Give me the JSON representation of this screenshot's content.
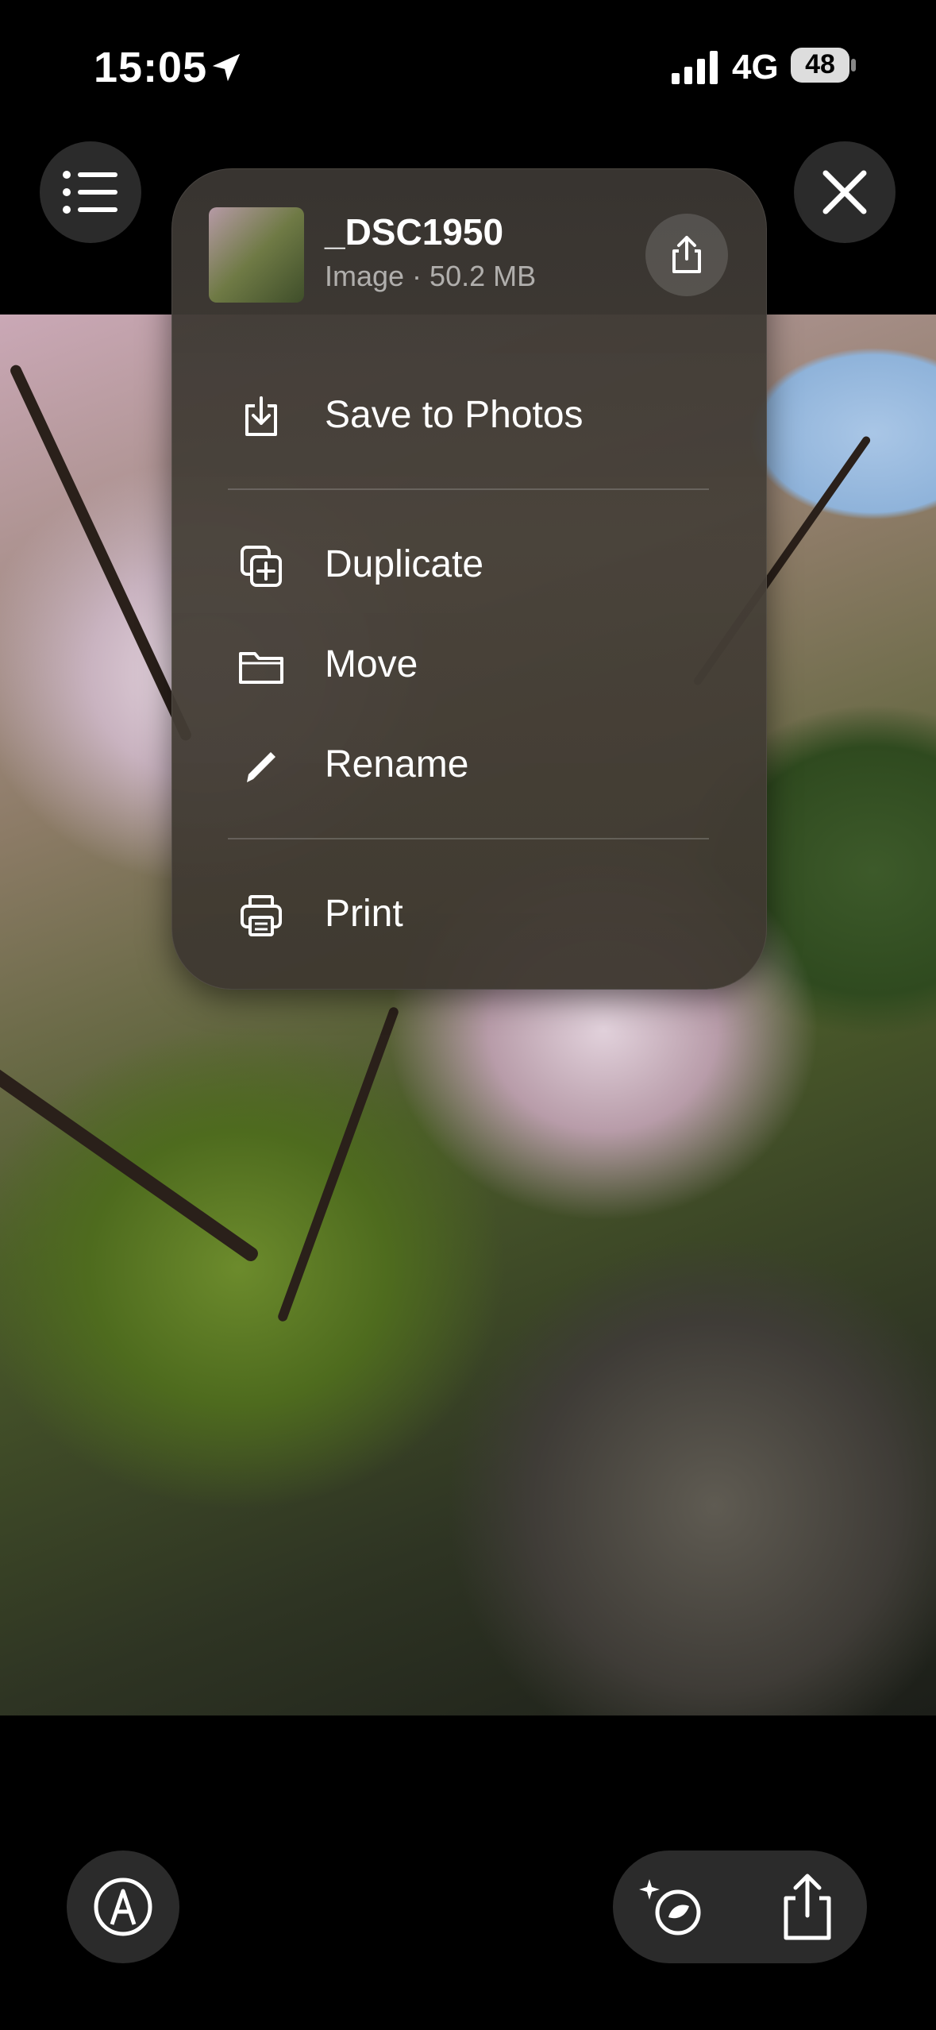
{
  "status_bar": {
    "time": "15:05",
    "network": "4G",
    "battery": "48"
  },
  "file": {
    "name": "_DSC1950",
    "meta": "Image · 50.2 MB"
  },
  "menu": {
    "items": [
      {
        "label": "Save to Photos",
        "icon": "save-to-photos-icon"
      },
      {
        "label": "Duplicate",
        "icon": "duplicate-icon"
      },
      {
        "label": "Move",
        "icon": "folder-icon"
      },
      {
        "label": "Rename",
        "icon": "pencil-icon"
      },
      {
        "label": "Print",
        "icon": "printer-icon"
      }
    ]
  },
  "colors": {
    "background": "#000000",
    "button_bg": "#2b2b2b",
    "menu_bg": "#3e3a34"
  }
}
